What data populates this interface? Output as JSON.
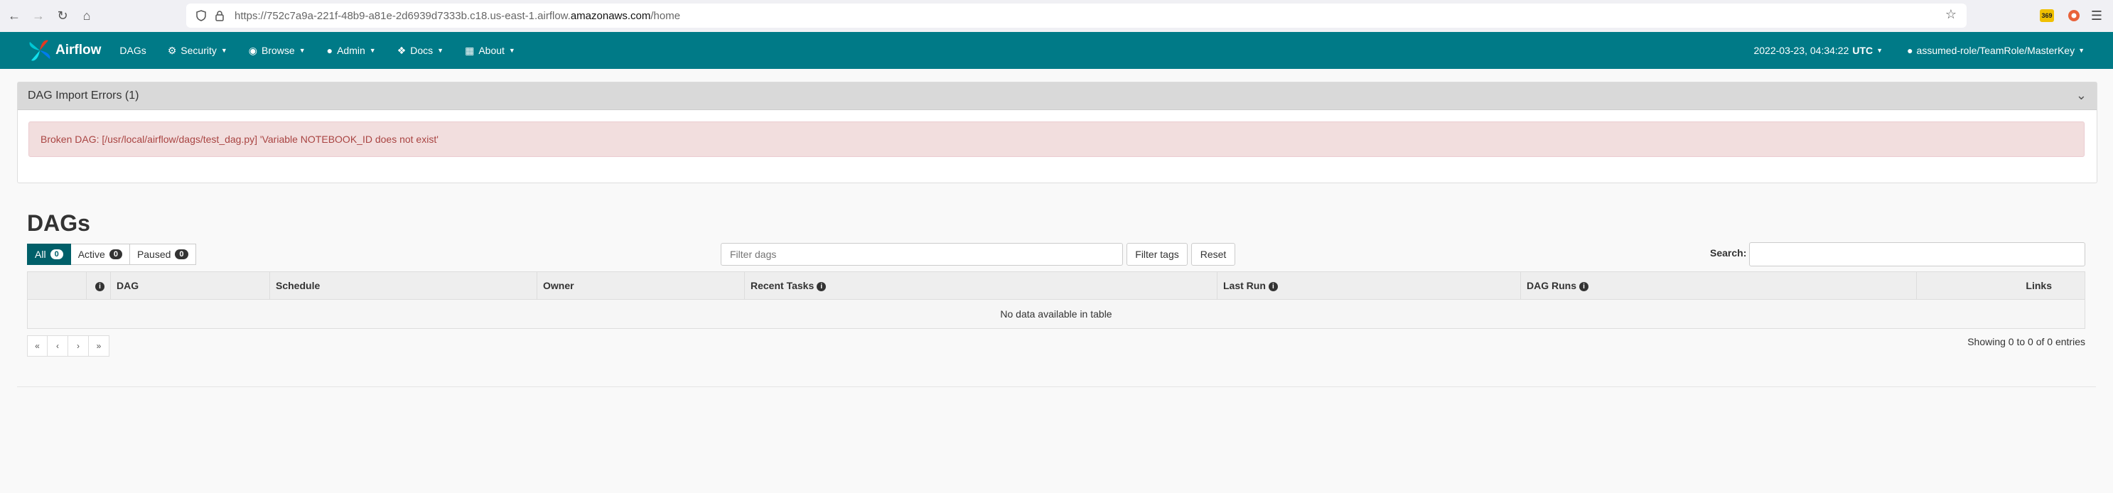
{
  "browser": {
    "url_prefix": "https://752c7a9a-221f-48b9-a81e-2d6939d7333b.c18.us-east-1.airflow.",
    "url_domain": "amazonaws.com",
    "url_suffix": "/home",
    "ext_badge": "369"
  },
  "nav": {
    "brand": "Airflow",
    "items": [
      {
        "label": "DAGs"
      },
      {
        "label": "Security"
      },
      {
        "label": "Browse"
      },
      {
        "label": "Admin"
      },
      {
        "label": "Docs"
      },
      {
        "label": "About"
      }
    ],
    "datetime": "2022-03-23, 04:34:22",
    "timezone": "UTC",
    "user": "assumed-role/TeamRole/MasterKey"
  },
  "import_errors": {
    "title": "DAG Import Errors (1)",
    "message": "Broken DAG: [/usr/local/airflow/dags/test_dag.py] 'Variable NOTEBOOK_ID does not exist'"
  },
  "dags": {
    "title": "DAGs",
    "filters": [
      {
        "label": "All",
        "count": "0"
      },
      {
        "label": "Active",
        "count": "0"
      },
      {
        "label": "Paused",
        "count": "0"
      }
    ],
    "filter_placeholder": "Filter dags",
    "filter_tags_label": "Filter tags",
    "reset_label": "Reset",
    "search_label": "Search:",
    "columns": [
      "DAG",
      "Schedule",
      "Owner",
      "Recent Tasks",
      "Last Run",
      "DAG Runs",
      "Links"
    ],
    "empty_message": "No data available in table",
    "pager": [
      "«",
      "‹",
      "›",
      "»"
    ],
    "showing": "Showing 0 to 0 of 0 entries"
  },
  "colors": {
    "navbar": "#007a87",
    "active_filter": "#005f69",
    "alert_bg": "#f2dede",
    "alert_text": "#a94442"
  }
}
